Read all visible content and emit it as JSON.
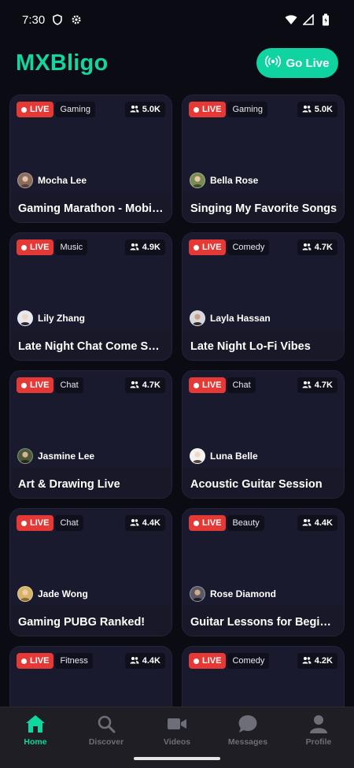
{
  "status_bar": {
    "time": "7:30"
  },
  "header": {
    "brand": "MXBligo",
    "go_live_label": "Go Live"
  },
  "streams": [
    {
      "live_label": "LIVE",
      "category": "Gaming",
      "viewers": "5.0K",
      "streamer": "Mocha Lee",
      "title": "Gaming Marathon - Mobile ..."
    },
    {
      "live_label": "LIVE",
      "category": "Gaming",
      "viewers": "5.0K",
      "streamer": "Bella Rose",
      "title": "Singing My Favorite Songs"
    },
    {
      "live_label": "LIVE",
      "category": "Music",
      "viewers": "4.9K",
      "streamer": "Lily Zhang",
      "title": "Late Night Chat Come Say ..."
    },
    {
      "live_label": "LIVE",
      "category": "Comedy",
      "viewers": "4.7K",
      "streamer": "Layla Hassan",
      "title": "Late Night Lo-Fi Vibes"
    },
    {
      "live_label": "LIVE",
      "category": "Chat",
      "viewers": "4.7K",
      "streamer": "Jasmine Lee",
      "title": "Art & Drawing Live"
    },
    {
      "live_label": "LIVE",
      "category": "Chat",
      "viewers": "4.7K",
      "streamer": "Luna Belle",
      "title": "Acoustic Guitar Session"
    },
    {
      "live_label": "LIVE",
      "category": "Chat",
      "viewers": "4.4K",
      "streamer": "Jade Wong",
      "title": "Gaming PUBG Ranked!"
    },
    {
      "live_label": "LIVE",
      "category": "Beauty",
      "viewers": "4.4K",
      "streamer": "Rose Diamond",
      "title": "Guitar Lessons for Beginners"
    },
    {
      "live_label": "LIVE",
      "category": "Fitness",
      "viewers": "4.4K",
      "streamer": "",
      "title": ""
    },
    {
      "live_label": "LIVE",
      "category": "Comedy",
      "viewers": "4.2K",
      "streamer": "",
      "title": ""
    }
  ],
  "nav": {
    "home": "Home",
    "discover": "Discover",
    "videos": "Videos",
    "messages": "Messages",
    "profile": "Profile"
  },
  "colors": {
    "accent": "#12d6a0",
    "live_red": "#e53935",
    "background": "#0b0b14",
    "card": "#16162a"
  }
}
